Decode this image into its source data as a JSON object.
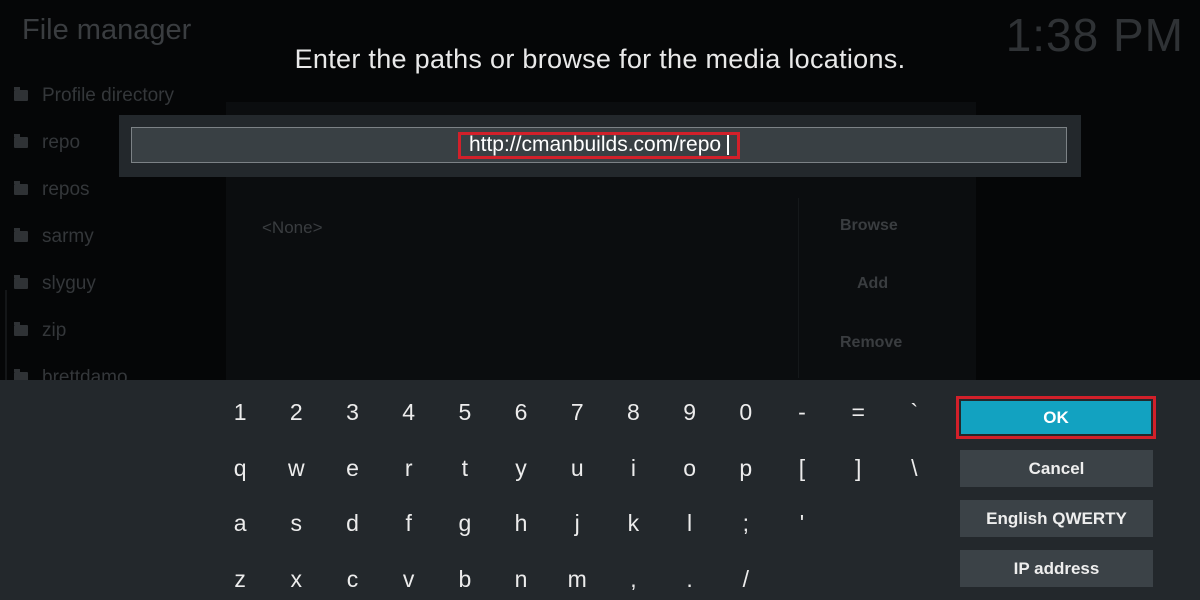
{
  "background": {
    "title": "File manager",
    "clock": "1:38 PM",
    "list_items": [
      "Profile directory",
      "repo",
      "repos",
      "sarmy",
      "slyguy",
      "zip",
      "brettdamo"
    ],
    "dialog_field": "<None>",
    "dialog_buttons": [
      "Browse",
      "Add",
      "Remove"
    ]
  },
  "dialog": {
    "heading": "Enter the paths or browse for the media locations.",
    "input_value": "http://cmanbuilds.com/repo"
  },
  "keyboard": {
    "rows": [
      [
        "1",
        "2",
        "3",
        "4",
        "5",
        "6",
        "7",
        "8",
        "9",
        "0",
        "-",
        "=",
        "`"
      ],
      [
        "q",
        "w",
        "e",
        "r",
        "t",
        "y",
        "u",
        "i",
        "o",
        "p",
        "[",
        "]",
        "\\"
      ],
      [
        "a",
        "s",
        "d",
        "f",
        "g",
        "h",
        "j",
        "k",
        "l",
        ";",
        "'"
      ],
      [
        "z",
        "x",
        "c",
        "v",
        "b",
        "n",
        "m",
        ",",
        ".",
        "/"
      ]
    ]
  },
  "buttons": {
    "ok": "OK",
    "cancel": "Cancel",
    "layout": "English QWERTY",
    "ip": "IP address"
  },
  "colors": {
    "accent": "#12a2c1",
    "highlight": "#d2202a",
    "panel": "#23282c"
  }
}
